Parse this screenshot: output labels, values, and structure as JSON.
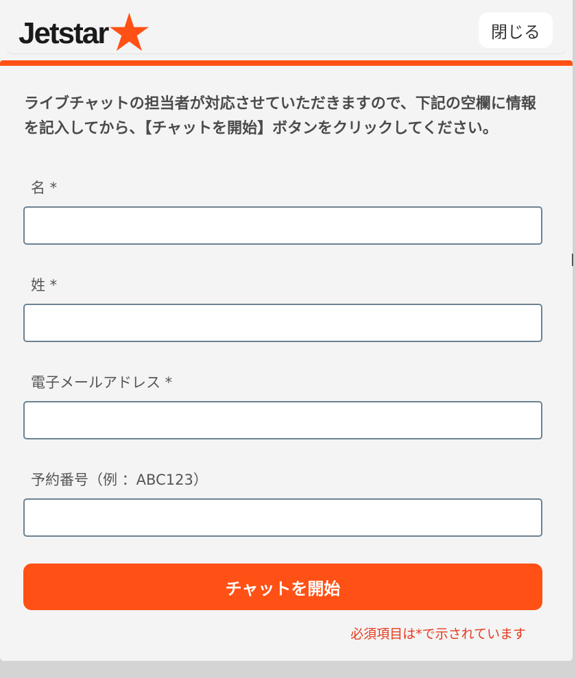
{
  "header": {
    "logo_text": "Jetstar",
    "close_label": "閉じる"
  },
  "colors": {
    "accent": "#ff5115",
    "required_text": "#e53a1c",
    "input_border": "#6b8191"
  },
  "form": {
    "intro": "ライブチャットの担当者が対応させていただきますので、下記の空欄に情報を記入してから、【チャットを開始】ボタンをクリックしてください。",
    "fields": [
      {
        "label": "名 *",
        "value": "",
        "placeholder": ""
      },
      {
        "label": "姓 *",
        "value": "",
        "placeholder": ""
      },
      {
        "label": "電子メールアドレス *",
        "value": "",
        "placeholder": ""
      },
      {
        "label": "予約番号（例 ：ABC123）",
        "value": "",
        "placeholder": ""
      }
    ],
    "submit_label": "チャットを開始",
    "required_note": "必須項目は*で示されています"
  },
  "icons": {
    "logo_star": "star-icon"
  }
}
